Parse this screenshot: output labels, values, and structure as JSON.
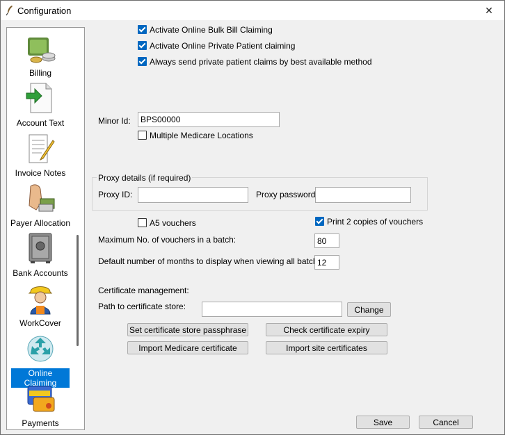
{
  "window": {
    "title": "Configuration",
    "app_icon": "feather-icon",
    "close_icon": "close-icon"
  },
  "sidebar": {
    "items": [
      {
        "label": "Billing",
        "icon": "money-stack-icon"
      },
      {
        "label": "Account Text",
        "icon": "document-arrow-icon"
      },
      {
        "label": "Invoice Notes",
        "icon": "notepad-pencil-icon"
      },
      {
        "label": "Payer Allocation",
        "icon": "hand-cash-icon"
      },
      {
        "label": "Bank Accounts",
        "icon": "safe-icon"
      },
      {
        "label": "WorkCover",
        "icon": "hardhat-worker-icon"
      },
      {
        "label": "Online Claiming",
        "icon": "recycle-arrows-icon",
        "selected": true
      },
      {
        "label": "Payments",
        "icon": "credit-card-icon"
      }
    ]
  },
  "options": {
    "bulk_bill": {
      "label": "Activate Online Bulk Bill Claiming",
      "checked": true
    },
    "private_patient": {
      "label": "Activate Online Private Patient claiming",
      "checked": true
    },
    "best_method": {
      "label": "Always send private patient claims by best available method",
      "checked": true
    }
  },
  "minor_id": {
    "label": "Minor Id:",
    "value": "BPS00000"
  },
  "multiple_locations": {
    "label": "Multiple Medicare Locations",
    "checked": false
  },
  "proxy": {
    "legend": "Proxy details (if required)",
    "id_label": "Proxy ID:",
    "id_value": "",
    "password_label": "Proxy password:",
    "password_value": ""
  },
  "vouchers": {
    "a5": {
      "label": "A5 vouchers",
      "checked": false
    },
    "print_two": {
      "label": "Print 2 copies of vouchers",
      "checked": true
    },
    "max_label": "Maximum No. of vouchers in a batch:",
    "max_value": "80",
    "months_label": "Default number of months to display when viewing all batches:",
    "months_value": "12"
  },
  "certificate": {
    "heading": "Certificate management:",
    "path_label": "Path to certificate store:",
    "path_value": "",
    "change_button": "Change",
    "set_passphrase_button": "Set certificate store passphrase",
    "check_expiry_button": "Check certificate expiry",
    "import_medicare_button": "Import Medicare certificate",
    "import_site_button": "Import site certificates"
  },
  "footer": {
    "save_button": "Save",
    "cancel_button": "Cancel"
  }
}
